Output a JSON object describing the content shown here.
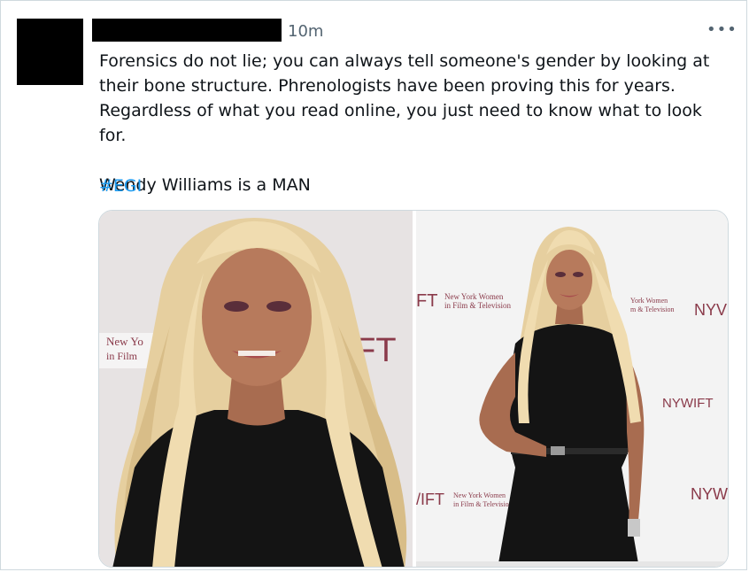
{
  "tweet": {
    "timestamp": "10m",
    "more_icon": "more-horizontal-icon",
    "text": "Forensics do not lie; you can always tell someone's gender by looking at their bone structure. Phrenologists have been proving this for years. Regardless of what you read online, you just need to know what to look for.\n\nWendy Williams is a MAN",
    "hashtag": "#EGI"
  },
  "media": {
    "photo_left": {
      "backdrop_text_1": "New Yo",
      "backdrop_text_2": "in Film",
      "backdrop_logo": "/IFT"
    },
    "photo_right": {
      "backdrop_logo_top": "FT",
      "backdrop_text_top_1": "New York Women",
      "backdrop_text_top_2": "in Film & Television",
      "backdrop_text_right_1": "York Women",
      "backdrop_text_right_2": "m & Television",
      "backdrop_logo_right": "NYV",
      "backdrop_logo_mid": "NYWIFT",
      "backdrop_logo_bottom": "/IFT",
      "backdrop_text_bottom_1": "New York Women",
      "backdrop_text_bottom_2": "in Film & Television",
      "backdrop_logo_bottom_right": "NYW"
    }
  },
  "colors": {
    "text": "#0f1419",
    "secondary": "#536471",
    "link": "#1d9bf0",
    "backdrop_left": "#e7e3e3",
    "backdrop_right": "#f3f3f3",
    "backdrop_print": "#8a3a4a",
    "hair": "#e6cf9f",
    "dress": "#141414",
    "skin": "#b77a5c"
  }
}
